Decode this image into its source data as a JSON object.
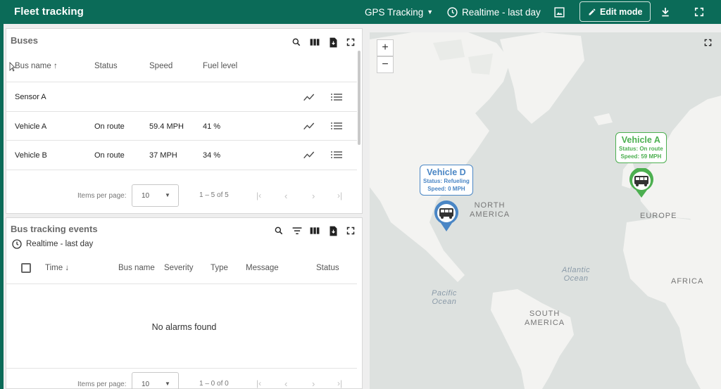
{
  "app": {
    "title": "Fleet tracking"
  },
  "toolbar": {
    "dashboard_state": "GPS Tracking",
    "timewindow": "Realtime - last day",
    "edit_mode_label": "Edit mode"
  },
  "buses": {
    "title": "Buses",
    "columns": [
      "Bus name",
      "Status",
      "Speed",
      "Fuel level"
    ],
    "rows": [
      {
        "name": "Sensor A",
        "status": "",
        "speed": "",
        "fuel": ""
      },
      {
        "name": "Vehicle A",
        "status": "On route",
        "speed": "59.4 MPH",
        "fuel": "41 %"
      },
      {
        "name": "Vehicle B",
        "status": "On route",
        "speed": "37 MPH",
        "fuel": "34 %"
      }
    ],
    "items_per_page_label": "Items per page:",
    "items_per_page_value": "10",
    "range": "1 – 5 of 5"
  },
  "events": {
    "title": "Bus tracking events",
    "timewindow": "Realtime - last day",
    "columns": [
      "Time",
      "Bus name",
      "Severity",
      "Type",
      "Message",
      "Status"
    ],
    "empty_text": "No alarms found",
    "items_per_page_label": "Items per page:",
    "items_per_page_value": "10",
    "range": "1 – 0 of 0"
  },
  "map": {
    "zoom_in": "+",
    "zoom_out": "−",
    "labels": {
      "north_america": "NORTH\nAMERICA",
      "europe": "EUROPE",
      "africa": "AFRICA",
      "south_america": "SOUTH\nAMERICA",
      "atlantic": "Atlantic\nOcean",
      "pacific": "Pacific\nOcean"
    },
    "vehicles": [
      {
        "name": "Vehicle D",
        "status": "Status: Refueling",
        "speed": "Speed: 0 MPH",
        "color": "#4a86c5"
      },
      {
        "name": "Vehicle A",
        "status": "Status: On route",
        "speed": "Speed: 59 MPH",
        "color": "#4caf50"
      }
    ]
  },
  "colors": {
    "brand": "#0b6b58"
  }
}
